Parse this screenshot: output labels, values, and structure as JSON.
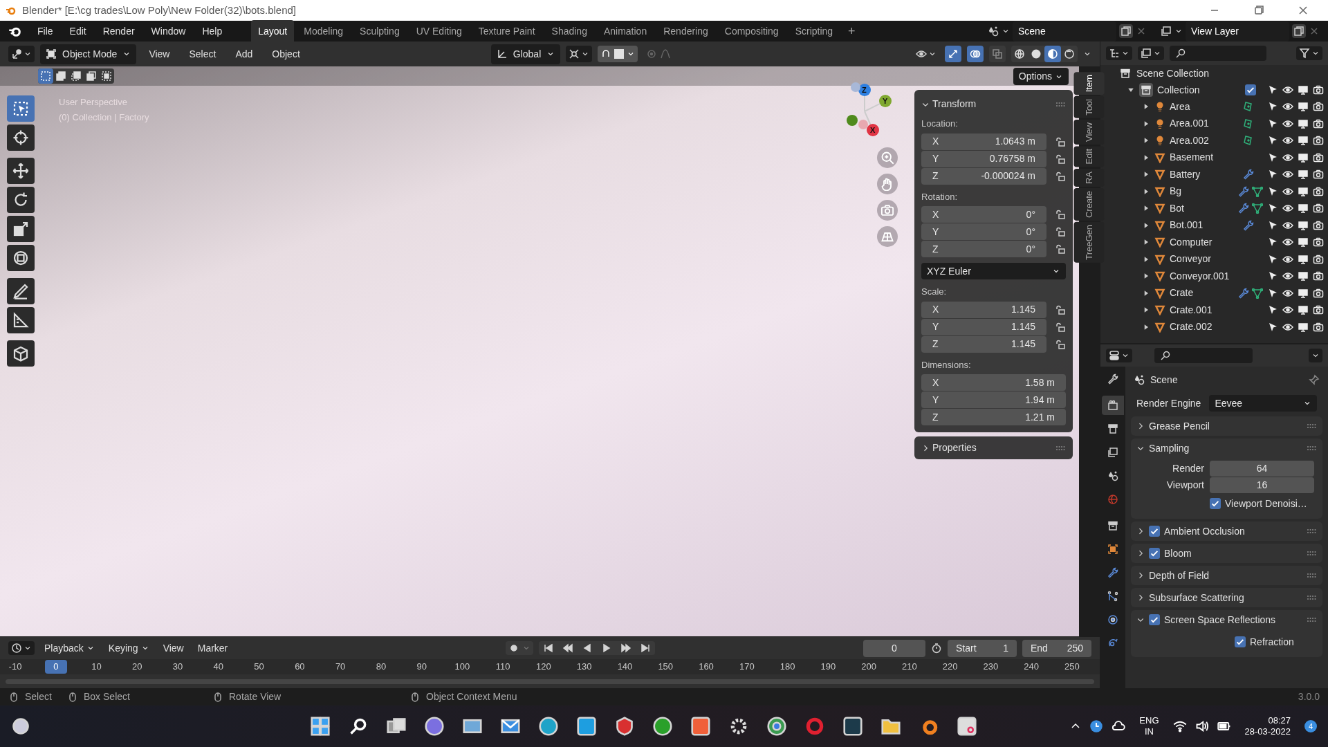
{
  "window": {
    "title": "Blender* [E:\\cg trades\\Low Poly\\New Folder(32)\\bots.blend]"
  },
  "menu": [
    "File",
    "Edit",
    "Render",
    "Window",
    "Help"
  ],
  "workspaces": [
    {
      "label": "Layout",
      "selected": true
    },
    {
      "label": "Modeling",
      "selected": false
    },
    {
      "label": "Sculpting",
      "selected": false
    },
    {
      "label": "UV Editing",
      "selected": false
    },
    {
      "label": "Texture Paint",
      "selected": false
    },
    {
      "label": "Shading",
      "selected": false
    },
    {
      "label": "Animation",
      "selected": false
    },
    {
      "label": "Rendering",
      "selected": false
    },
    {
      "label": "Compositing",
      "selected": false
    },
    {
      "label": "Scripting",
      "selected": false
    }
  ],
  "add_workspace": "+",
  "scene": "Scene",
  "view_layer": "View Layer",
  "viewport": {
    "mode": "Object Mode",
    "menus": [
      "View",
      "Select",
      "Add",
      "Object"
    ],
    "orientation": "Global",
    "toggles": [
      {
        "kind": "gizmo",
        "on": true
      },
      {
        "kind": "overlay",
        "on": true
      },
      {
        "kind": "xray",
        "on": false
      }
    ],
    "snap": {
      "on": true
    },
    "proportional": {
      "on": false
    },
    "shading": [
      {
        "kind": "wireframe",
        "selected": false
      },
      {
        "kind": "solid",
        "selected": false
      },
      {
        "kind": "material",
        "selected": true
      },
      {
        "kind": "rendered",
        "selected": false
      }
    ],
    "select_modes": [
      {
        "kind": "set",
        "selected": true
      },
      {
        "kind": "extend",
        "selected": false
      },
      {
        "kind": "subtract",
        "selected": false
      },
      {
        "kind": "invert",
        "selected": false
      },
      {
        "kind": "intersect",
        "selected": false
      }
    ],
    "options": "Options",
    "overlay_text": [
      "User Perspective",
      "(0) Collection | Factory"
    ],
    "axes": [
      "Z",
      "Y",
      "X"
    ],
    "tools": [
      {
        "kind": "select",
        "selected": true
      },
      {
        "kind": "cursor",
        "selected": false
      },
      {
        "kind": "move",
        "selected": false
      },
      {
        "kind": "rotate",
        "selected": false
      },
      {
        "kind": "scale",
        "selected": false
      },
      {
        "kind": "transform",
        "selected": false
      },
      {
        "kind": "annotate",
        "selected": false
      },
      {
        "kind": "measure",
        "selected": false
      },
      {
        "kind": "add_cube",
        "selected": false
      }
    ]
  },
  "sidebar": {
    "tabs": [
      {
        "label": "Item",
        "selected": true
      },
      {
        "label": "Tool",
        "selected": false
      },
      {
        "label": "View",
        "selected": false
      },
      {
        "label": "Edit",
        "selected": false
      },
      {
        "label": "RA",
        "selected": false
      },
      {
        "label": "Create",
        "selected": false
      },
      {
        "label": "TreeGen",
        "selected": false
      }
    ],
    "transform": {
      "title": "Transform",
      "expanded": true,
      "groups": [
        {
          "label": "Location:",
          "lock": true,
          "rows": [
            {
              "axis": "X",
              "value": "1.0643 m"
            },
            {
              "axis": "Y",
              "value": "0.76758 m"
            },
            {
              "axis": "Z",
              "value": "-0.000024 m"
            }
          ]
        },
        {
          "label": "Rotation:",
          "lock": true,
          "rows": [
            {
              "axis": "X",
              "value": "0°"
            },
            {
              "axis": "Y",
              "value": "0°"
            },
            {
              "axis": "Z",
              "value": "0°"
            }
          ],
          "mode": "XYZ Euler"
        },
        {
          "label": "Scale:",
          "lock": true,
          "rows": [
            {
              "axis": "X",
              "value": "1.145"
            },
            {
              "axis": "Y",
              "value": "1.145"
            },
            {
              "axis": "Z",
              "value": "1.145"
            }
          ]
        },
        {
          "label": "Dimensions:",
          "lock": false,
          "rows": [
            {
              "axis": "X",
              "value": "1.58 m"
            },
            {
              "axis": "Y",
              "value": "1.94 m"
            },
            {
              "axis": "Z",
              "value": "1.21 m"
            }
          ]
        }
      ]
    },
    "properties": {
      "title": "Properties",
      "expanded": false
    }
  },
  "outliner": {
    "root": "Scene Collection",
    "collection": {
      "name": "Collection",
      "expanded": true,
      "checked": true
    },
    "items": [
      {
        "name": "Area",
        "kind": "light",
        "modifier": false,
        "data": true
      },
      {
        "name": "Area.001",
        "kind": "light",
        "modifier": false,
        "data": true
      },
      {
        "name": "Area.002",
        "kind": "light",
        "modifier": false,
        "data": true
      },
      {
        "name": "Basement",
        "kind": "mesh",
        "modifier": false,
        "data": false
      },
      {
        "name": "Battery",
        "kind": "mesh",
        "modifier": true,
        "data": false
      },
      {
        "name": "Bg",
        "kind": "mesh",
        "modifier": true,
        "data": true
      },
      {
        "name": "Bot",
        "kind": "mesh",
        "modifier": true,
        "data": true
      },
      {
        "name": "Bot.001",
        "kind": "mesh",
        "modifier": true,
        "data": false
      },
      {
        "name": "Computer",
        "kind": "mesh",
        "modifier": false,
        "data": false
      },
      {
        "name": "Conveyor",
        "kind": "mesh",
        "modifier": false,
        "data": false
      },
      {
        "name": "Conveyor.001",
        "kind": "mesh",
        "modifier": false,
        "data": false
      },
      {
        "name": "Crate",
        "kind": "mesh",
        "modifier": true,
        "data": true
      },
      {
        "name": "Crate.001",
        "kind": "mesh",
        "modifier": false,
        "data": false
      },
      {
        "name": "Crate.002",
        "kind": "mesh",
        "modifier": false,
        "data": false
      }
    ]
  },
  "properties": {
    "tabs": [
      {
        "kind": "tool",
        "selected": false
      },
      {
        "kind": "render",
        "selected": true
      },
      {
        "kind": "output",
        "selected": false
      },
      {
        "kind": "view_layer",
        "selected": false
      },
      {
        "kind": "scene",
        "selected": false
      },
      {
        "kind": "world",
        "selected": false
      },
      {
        "kind": "collection",
        "selected": false
      },
      {
        "kind": "object",
        "selected": false
      },
      {
        "kind": "modifiers",
        "selected": false
      },
      {
        "kind": "particles",
        "selected": false
      },
      {
        "kind": "physics",
        "selected": false
      },
      {
        "kind": "constraints",
        "selected": false
      }
    ],
    "context": "Scene",
    "engine_label": "Render Engine",
    "engine": "Eevee",
    "panels": [
      {
        "title": "Grease Pencil",
        "expanded": false
      },
      {
        "title": "Sampling",
        "expanded": true,
        "fields": [
          {
            "label": "Render",
            "value": "64"
          },
          {
            "label": "Viewport",
            "value": "16"
          }
        ],
        "options": [
          {
            "label": "Viewport Denoisi…",
            "checked": true
          }
        ]
      },
      {
        "title": "Ambient Occlusion",
        "expanded": false,
        "checked": true
      },
      {
        "title": "Bloom",
        "expanded": false,
        "checked": true
      },
      {
        "title": "Depth of Field",
        "expanded": false
      },
      {
        "title": "Subsurface Scattering",
        "expanded": false
      },
      {
        "title": "Screen Space Reflections",
        "expanded": true,
        "checked": true,
        "options": [
          {
            "label": "Refraction",
            "checked": true
          }
        ]
      }
    ]
  },
  "timeline": {
    "menus": [
      "Playback",
      "Keying",
      "View",
      "Marker"
    ],
    "current_frame": "0",
    "start_label": "Start",
    "start": "1",
    "end_label": "End",
    "end": "250",
    "ruler": [
      {
        "label": "-10",
        "selected": false
      },
      {
        "label": "0",
        "selected": true
      },
      {
        "label": "10",
        "selected": false
      },
      {
        "label": "20",
        "selected": false
      },
      {
        "label": "30",
        "selected": false
      },
      {
        "label": "40",
        "selected": false
      },
      {
        "label": "50",
        "selected": false
      },
      {
        "label": "60",
        "selected": false
      },
      {
        "label": "70",
        "selected": false
      },
      {
        "label": "80",
        "selected": false
      },
      {
        "label": "90",
        "selected": false
      },
      {
        "label": "100",
        "selected": false
      },
      {
        "label": "110",
        "selected": false
      },
      {
        "label": "120",
        "selected": false
      },
      {
        "label": "130",
        "selected": false
      },
      {
        "label": "140",
        "selected": false
      },
      {
        "label": "150",
        "selected": false
      },
      {
        "label": "160",
        "selected": false
      },
      {
        "label": "170",
        "selected": false
      },
      {
        "label": "180",
        "selected": false
      },
      {
        "label": "190",
        "selected": false
      },
      {
        "label": "200",
        "selected": false
      },
      {
        "label": "210",
        "selected": false
      },
      {
        "label": "220",
        "selected": false
      },
      {
        "label": "230",
        "selected": false
      },
      {
        "label": "240",
        "selected": false
      },
      {
        "label": "250",
        "selected": false
      }
    ]
  },
  "status_bar": {
    "hints": [
      "Select",
      "Box Select",
      "Rotate View",
      "Object Context Menu"
    ],
    "version": "3.0.0"
  },
  "taskbar": {
    "language": "ENG",
    "region": "IN",
    "time": "08:27",
    "date": "28-03-2022",
    "notifications": "4"
  }
}
